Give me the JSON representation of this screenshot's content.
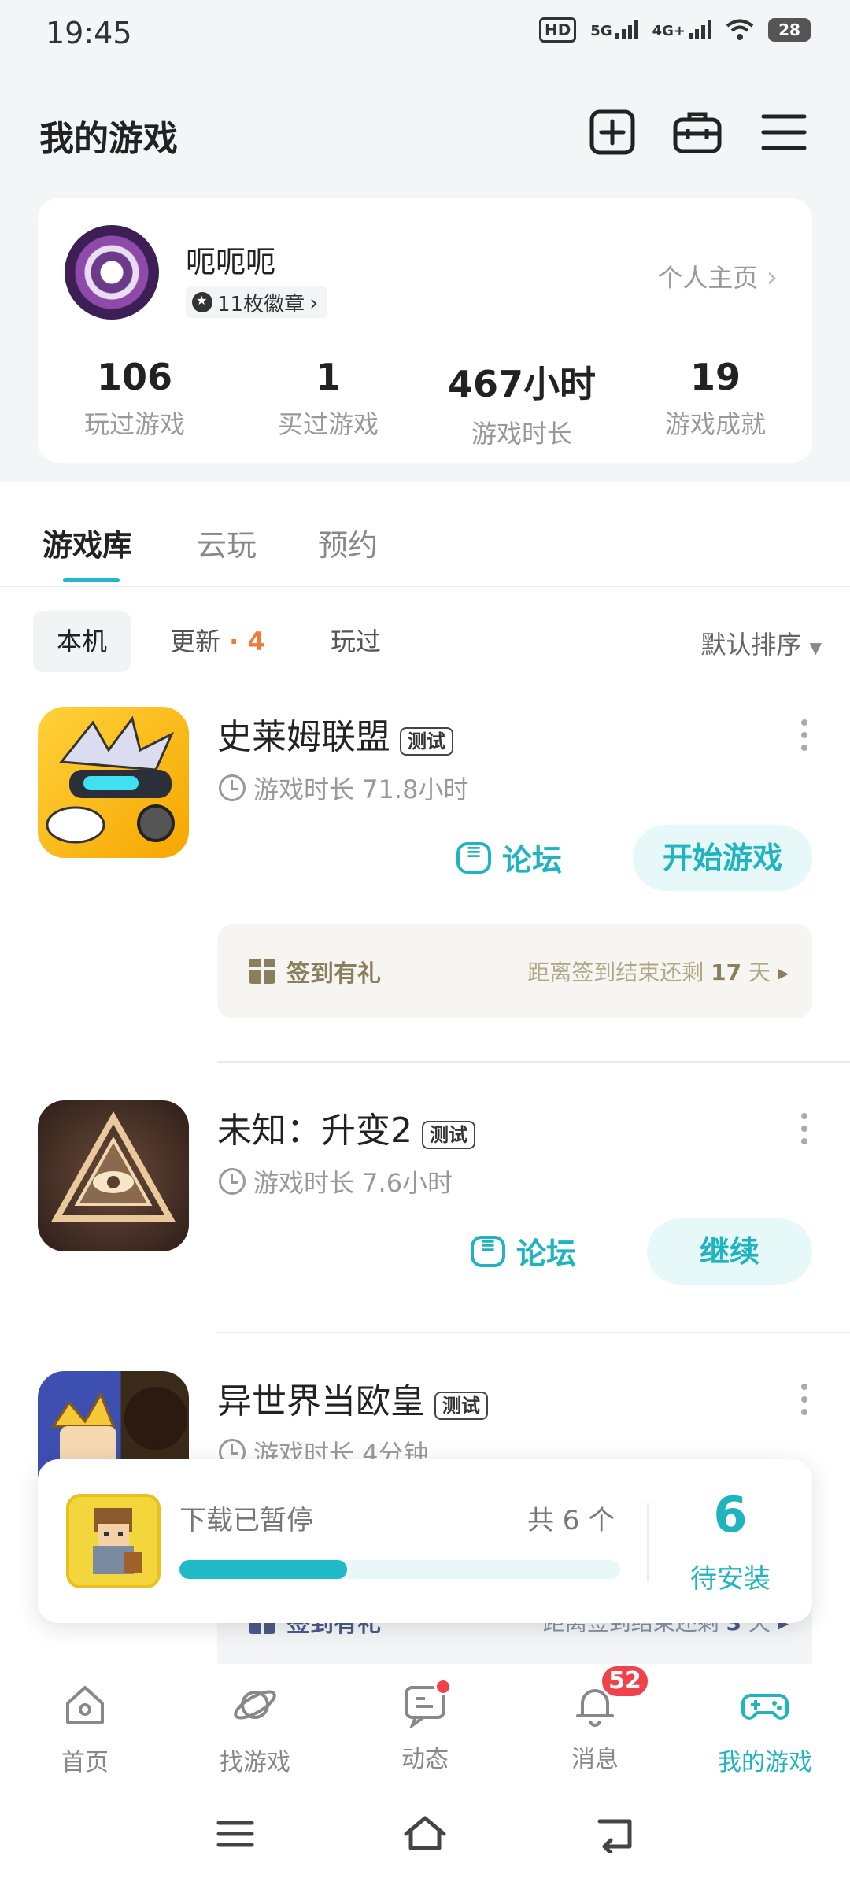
{
  "status_bar": {
    "time": "19:45",
    "network": "5G",
    "network2": "4G+",
    "hd": "HD",
    "battery": "28"
  },
  "header": {
    "title": "我的游戏",
    "icons": [
      "add-square-icon",
      "toolbox-icon",
      "menu-icon"
    ]
  },
  "profile": {
    "username": "呃呃呃",
    "badges": "11枚徽章",
    "homepage_link": "个人主页",
    "stats": [
      {
        "value": "106",
        "label": "玩过游戏"
      },
      {
        "value": "1",
        "label": "买过游戏"
      },
      {
        "value": "467小时",
        "label": "游戏时长"
      },
      {
        "value": "19",
        "label": "游戏成就"
      }
    ]
  },
  "tabs": [
    "游戏库",
    "云玩",
    "预约"
  ],
  "filters": {
    "local": "本机",
    "updates": "更新",
    "updates_count": "4",
    "played": "玩过",
    "sort": "默认排序"
  },
  "games": [
    {
      "name": "史莱姆联盟",
      "tag": "测试",
      "playtime": "游戏时长 71.8小时",
      "forum": "论坛",
      "action": "开始游戏",
      "gift": {
        "label": "签到有礼",
        "prefix": "距离签到结束还剩",
        "days": "17",
        "unit": "天"
      }
    },
    {
      "name": "未知：升变2",
      "tag": "测试",
      "playtime": "游戏时长 7.6小时",
      "forum": "论坛",
      "action": "继续"
    },
    {
      "name": "异世界当欧皇",
      "tag": "测试",
      "playtime": "游戏时长 4分钟",
      "gift": {
        "label": "签到有礼",
        "prefix": "距离签到结束还剩",
        "days": "3",
        "unit": "天"
      }
    }
  ],
  "download": {
    "status": "下载已暂停",
    "count": "共 6 个",
    "progress": 0.38,
    "pending_count": "6",
    "pending_label": "待安装"
  },
  "bottom_nav": [
    {
      "label": "首页",
      "icon": "home-icon"
    },
    {
      "label": "找游戏",
      "icon": "planet-icon"
    },
    {
      "label": "动态",
      "icon": "chat-icon"
    },
    {
      "label": "消息",
      "icon": "bell-icon",
      "badge": "52"
    },
    {
      "label": "我的游戏",
      "icon": "gamepad-icon"
    }
  ],
  "colors": {
    "accent": "#1fb4bf",
    "badge_red": "#f0424a",
    "update_orange": "#f07a3a"
  }
}
